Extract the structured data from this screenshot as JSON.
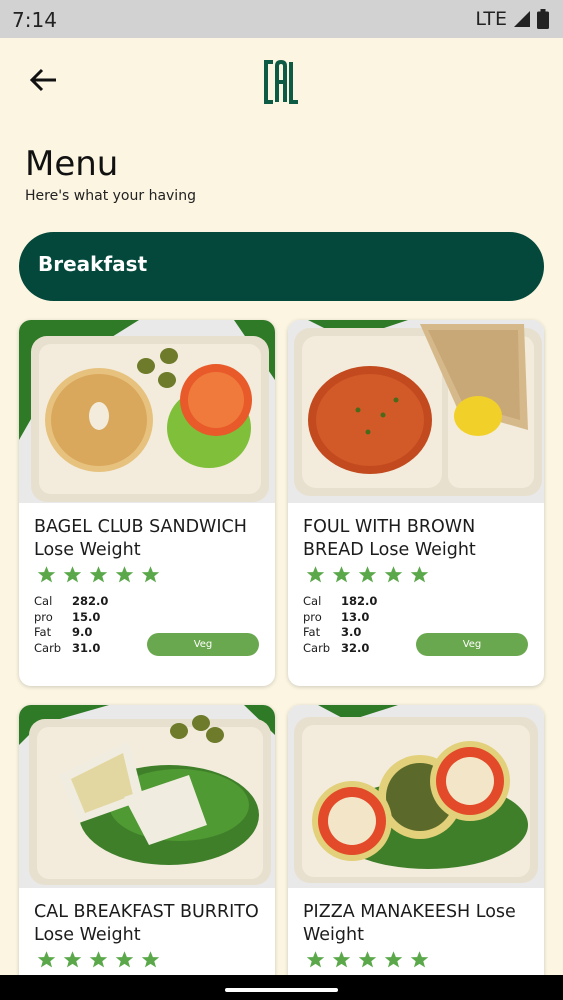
{
  "status": {
    "time": "7:14",
    "network": "LTE"
  },
  "header": {
    "back_icon": "arrow-left-icon",
    "logo_text": "CAL"
  },
  "page": {
    "title": "Menu",
    "subtitle": "Here's what your having"
  },
  "category": {
    "label": "Breakfast"
  },
  "colors": {
    "background": "#fbf5e2",
    "brand_green": "#03483a",
    "logo_green": "#0d5a45",
    "star_green": "#5aa84a",
    "veg_green": "#6aa84f"
  },
  "meals": [
    {
      "name": "BAGEL CLUB SANDWICH Lose Weight",
      "rating": 5,
      "nutrition": {
        "cal": "282.0",
        "pro": "15.0",
        "fat": "9.0",
        "carb": "31.0"
      },
      "tag": "Veg"
    },
    {
      "name": "FOUL  WITH BROWN BREAD Lose Weight",
      "rating": 5,
      "nutrition": {
        "cal": "182.0",
        "pro": "13.0",
        "fat": "3.0",
        "carb": "32.0"
      },
      "tag": "Veg"
    },
    {
      "name": "CAL BREAKFAST BURRITO Lose Weight",
      "rating": 5
    },
    {
      "name": "PIZZA MANAKEESH Lose Weight",
      "rating": 5
    }
  ],
  "nutrition_labels": {
    "cal": "Cal",
    "pro": "pro",
    "fat": "Fat",
    "carb": "Carb"
  }
}
